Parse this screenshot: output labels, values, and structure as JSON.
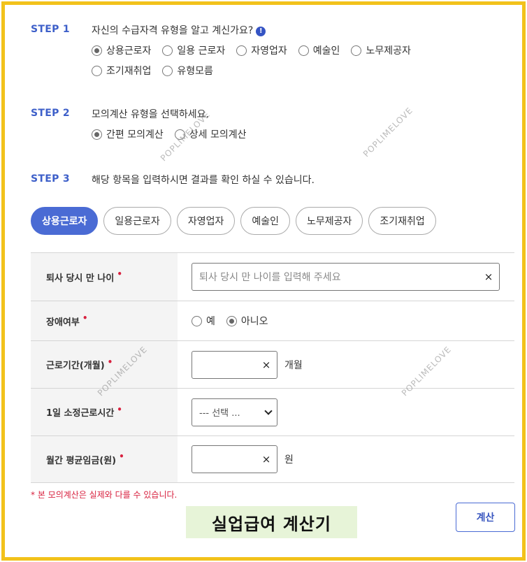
{
  "step1": {
    "label": "STEP 1",
    "question": "자신의 수급자격 유형을 알고 계신가요?",
    "info_icon": "!",
    "options": [
      "상용근로자",
      "일용 근로자",
      "자영업자",
      "예술인",
      "노무제공자",
      "조기재취업",
      "유형모름"
    ],
    "selected": "상용근로자"
  },
  "step2": {
    "label": "STEP 2",
    "question": "모의계산 유형을 선택하세요.",
    "options": [
      "간편 모의계산",
      "상세 모의계산"
    ],
    "selected": "간편 모의계산"
  },
  "step3": {
    "label": "STEP 3",
    "question": "해당 항목을 입력하시면 결과를 확인 하실 수 있습니다."
  },
  "tabs": [
    "상용근로자",
    "일용근로자",
    "자영업자",
    "예술인",
    "노무제공자",
    "조기재취업"
  ],
  "active_tab": "상용근로자",
  "form": {
    "age_label": "퇴사 당시 만 나이",
    "age_placeholder": "퇴사 당시 만 나이를 입력해 주세요",
    "disability_label": "장애여부",
    "disability_options": [
      "예",
      "아니오"
    ],
    "disability_selected": "아니오",
    "period_label": "근로기간(개월)",
    "period_unit": "개월",
    "hours_label": "1일 소정근로시간",
    "hours_select": "--- 선택 ...",
    "wage_label": "월간 평균임금(원)",
    "wage_unit": "원",
    "required_mark": "•",
    "clear_glyph": "×"
  },
  "note": "* 본 모의계산은 실제와 다를 수 있습니다.",
  "title_badge": "실업급여 계산기",
  "calc_button": "계산",
  "watermark": "POPLIMELOVE",
  "colors": {
    "accent": "#4a6bd4",
    "step": "#3d5fc9",
    "required": "#d8213f",
    "frame": "#f2c21b",
    "badge_bg": "#e7f4d8"
  }
}
